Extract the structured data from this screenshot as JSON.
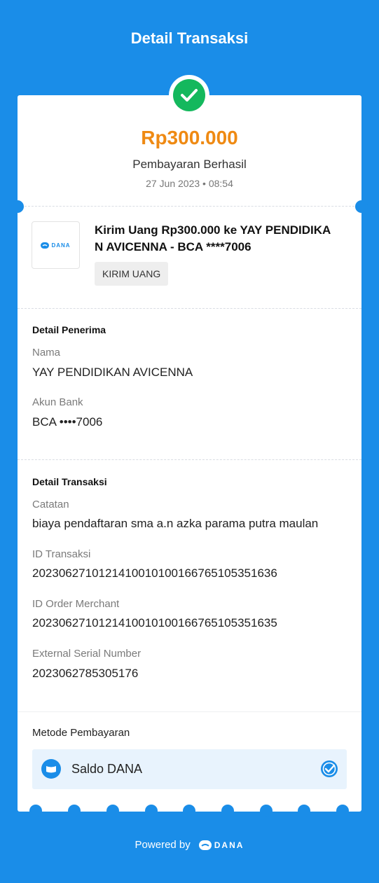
{
  "header": {
    "title": "Detail Transaksi"
  },
  "summary": {
    "amount": "Rp300.000",
    "status": "Pembayaran Berhasil",
    "datetime": "27 Jun 2023 • 08:54",
    "status_icon": "check-circle-icon",
    "status_color": "#14b85d",
    "amount_color": "#ef8a13"
  },
  "transaction": {
    "merchant_logo_text": "DANA",
    "title": "Kirim Uang Rp300.000 ke YAY PENDIDIKAN AVICENNA - BCA ****7006",
    "type_badge": "KIRIM UANG"
  },
  "recipient": {
    "heading": "Detail Penerima",
    "name_label": "Nama",
    "name_value": "YAY PENDIDIKAN AVICENNA",
    "bank_label": "Akun Bank",
    "bank_value": "BCA ••••7006"
  },
  "details": {
    "heading": "Detail Transaksi",
    "note_label": "Catatan",
    "note_value": "biaya pendaftaran sma a.n azka parama putra maulan",
    "tx_id_label": "ID Transaksi",
    "tx_id_value": "2023062710121410010100166765105351636",
    "order_id_label": "ID Order Merchant",
    "order_id_value": "2023062710121410010100166765105351635",
    "serial_label": "External Serial Number",
    "serial_value": "2023062785305176"
  },
  "payment": {
    "heading": "Metode Pembayaran",
    "method": "Saldo DANA",
    "method_icon": "wallet-icon",
    "selected_icon": "check-badge-icon"
  },
  "footer": {
    "powered_by": "Powered by",
    "brand": "DANA"
  },
  "colors": {
    "brand": "#1a8de8",
    "success": "#14b85d",
    "amount": "#ef8a13"
  }
}
